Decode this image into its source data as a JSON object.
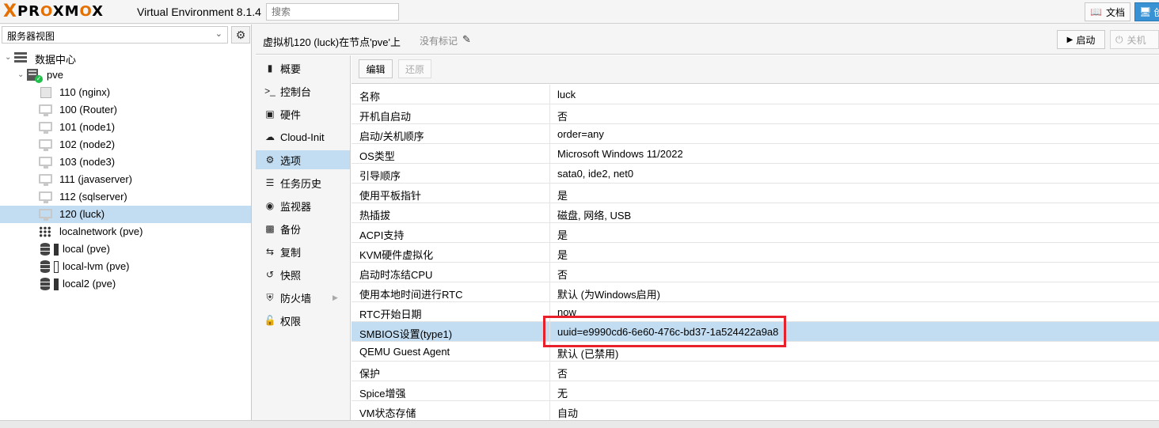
{
  "header": {
    "logo_x": "X",
    "logo_text_1": "PR",
    "logo_o1": "O",
    "logo_text_2": "XM",
    "logo_o2": "O",
    "logo_text_3": "X",
    "product": "Virtual Environment 8.1.4",
    "search_placeholder": "搜索",
    "docs_label": "文档",
    "create_label": "创"
  },
  "sidebar": {
    "view": "服务器视图",
    "tree": [
      {
        "label": "数据中心",
        "kind": "datacenter"
      },
      {
        "label": "pve",
        "kind": "node"
      },
      {
        "label": "110 (nginx)",
        "kind": "container"
      },
      {
        "label": "100 (Router)",
        "kind": "vm"
      },
      {
        "label": "101 (node1)",
        "kind": "vm"
      },
      {
        "label": "102 (node2)",
        "kind": "vm"
      },
      {
        "label": "103 (node3)",
        "kind": "vm"
      },
      {
        "label": "111 (javaserver)",
        "kind": "vm"
      },
      {
        "label": "112 (sqlserver)",
        "kind": "vm"
      },
      {
        "label": "120 (luck)",
        "kind": "vm",
        "selected": true
      },
      {
        "label": "localnetwork (pve)",
        "kind": "network"
      },
      {
        "label": "local (pve)",
        "kind": "storage"
      },
      {
        "label": "local-lvm (pve)",
        "kind": "storage"
      },
      {
        "label": "local2 (pve)",
        "kind": "storage"
      }
    ]
  },
  "main": {
    "title": "虚拟机120 (luck)在节点'pve'上",
    "no_tags": "没有标记",
    "start_label": "启动",
    "shutdown_label": "关机",
    "nav": [
      {
        "label": "概要",
        "icon": "book-icon"
      },
      {
        "label": "控制台",
        "icon": "terminal-icon"
      },
      {
        "label": "硬件",
        "icon": "desktop-icon"
      },
      {
        "label": "Cloud-Init",
        "icon": "cloud-icon"
      },
      {
        "label": "选项",
        "icon": "gear-icon",
        "selected": true
      },
      {
        "label": "任务历史",
        "icon": "list-icon"
      },
      {
        "label": "监视器",
        "icon": "eye-icon"
      },
      {
        "label": "备份",
        "icon": "floppy-icon"
      },
      {
        "label": "复制",
        "icon": "retweet-icon"
      },
      {
        "label": "快照",
        "icon": "history-icon"
      },
      {
        "label": "防火墙",
        "icon": "shield-icon"
      },
      {
        "label": "权限",
        "icon": "unlock-icon"
      }
    ],
    "toolbar": {
      "edit_label": "编辑",
      "revert_label": "还原"
    },
    "options": [
      {
        "key": "名称",
        "value": "luck"
      },
      {
        "key": "开机自启动",
        "value": "否"
      },
      {
        "key": "启动/关机顺序",
        "value": "order=any"
      },
      {
        "key": "OS类型",
        "value": "Microsoft Windows 11/2022"
      },
      {
        "key": "引导顺序",
        "value": "sata0, ide2, net0"
      },
      {
        "key": "使用平板指针",
        "value": "是"
      },
      {
        "key": "热插拔",
        "value": "磁盘, 网络, USB"
      },
      {
        "key": "ACPI支持",
        "value": "是"
      },
      {
        "key": "KVM硬件虚拟化",
        "value": "是"
      },
      {
        "key": "启动时冻结CPU",
        "value": "否"
      },
      {
        "key": "使用本地时间进行RTC",
        "value": "默认 (为Windows启用)"
      },
      {
        "key": "RTC开始日期",
        "value": "now"
      },
      {
        "key": "SMBIOS设置(type1)",
        "value": "uuid=e9990cd6-6e60-476c-bd37-1a524422a9a8",
        "selected": true
      },
      {
        "key": "QEMU Guest Agent",
        "value": "默认 (已禁用)"
      },
      {
        "key": "保护",
        "value": "否"
      },
      {
        "key": "Spice增强",
        "value": "无"
      },
      {
        "key": "VM状态存储",
        "value": "自动"
      }
    ]
  },
  "colors": {
    "accent": "#e57000",
    "selection": "#c2ddf2",
    "highlight_box": "#e8202a",
    "create_button": "#3892d4"
  }
}
